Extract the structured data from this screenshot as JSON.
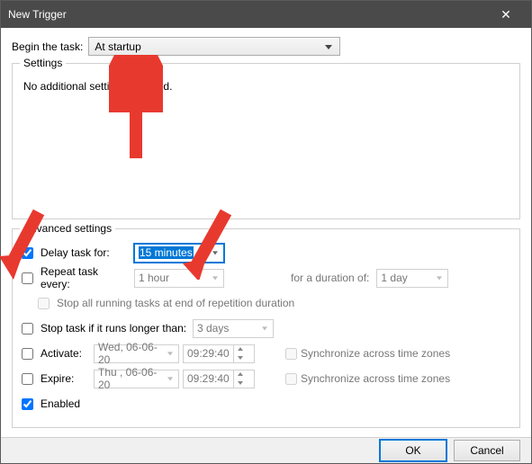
{
  "window": {
    "title": "New Trigger",
    "close_icon": "✕"
  },
  "begin_task": {
    "label": "Begin the task:",
    "value": "At startup"
  },
  "settings_group": {
    "title": "Settings",
    "text": "No additional settings required."
  },
  "advanced": {
    "title": "Advanced settings",
    "delay": {
      "checked": true,
      "label": "Delay task for:",
      "value": "15 minutes"
    },
    "repeat": {
      "checked": false,
      "label": "Repeat task every:",
      "value": "1 hour",
      "duration_label": "for a duration of:",
      "duration_value": "1 day"
    },
    "stop_end": {
      "checked": false,
      "label": "Stop all running tasks at end of repetition duration"
    },
    "stop_longer": {
      "checked": false,
      "label": "Stop task if it runs longer than:",
      "value": "3 days"
    },
    "activate": {
      "checked": false,
      "label": "Activate:",
      "date": "Wed, 06-06-20",
      "time": "09:29:40",
      "sync_label": "Synchronize across time zones"
    },
    "expire": {
      "checked": false,
      "label": "Expire:",
      "date": "Thu , 06-06-20",
      "time": "09:29:40",
      "sync_label": "Synchronize across time zones"
    },
    "enabled": {
      "checked": true,
      "label": "Enabled"
    }
  },
  "buttons": {
    "ok": "OK",
    "cancel": "Cancel"
  },
  "colors": {
    "accent": "#0078d7",
    "annotation": "#e8392f"
  }
}
